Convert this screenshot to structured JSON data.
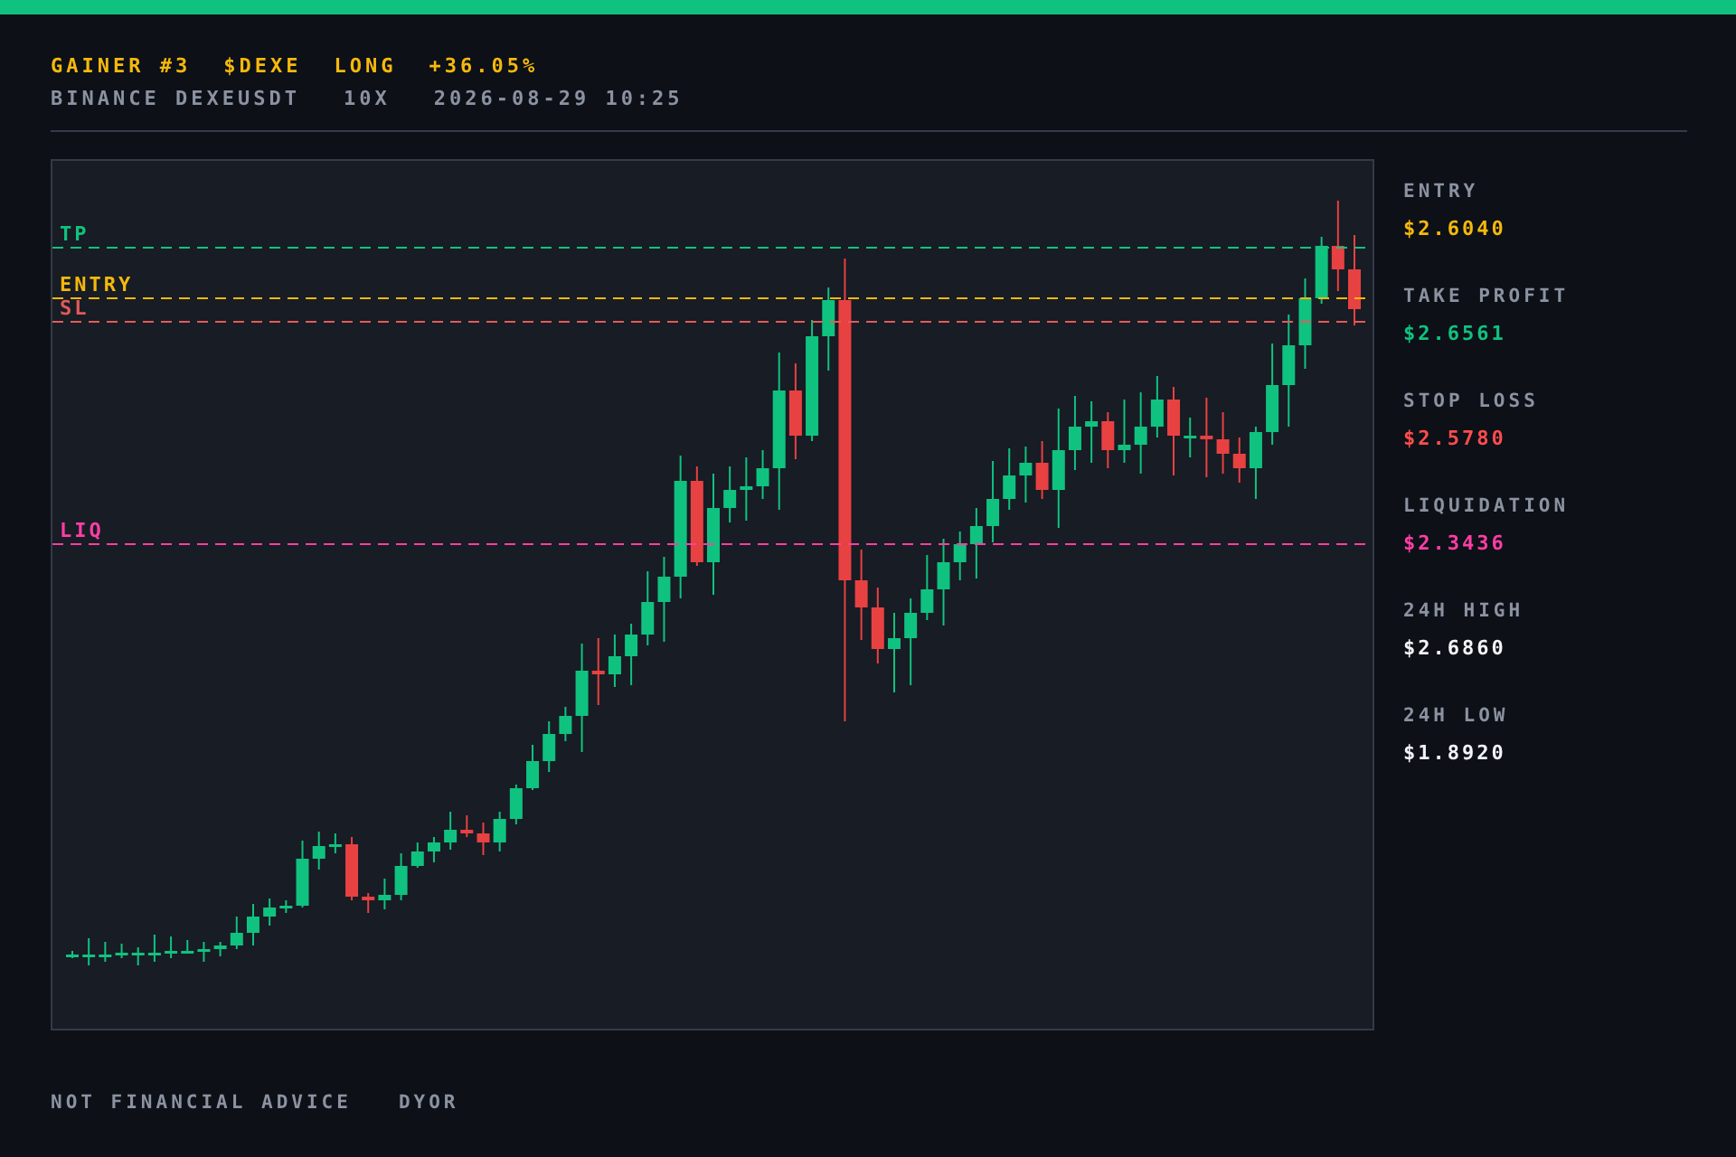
{
  "header": {
    "title_parts": [
      "GAINER #3",
      "$DEXE",
      "LONG",
      "+36.05%"
    ],
    "subtitle_parts": [
      "BINANCE DEXEUSDT",
      "10X",
      "2026-08-29 10:25"
    ]
  },
  "chart": {
    "levels": [
      {
        "label": "TP",
        "color": "#10c27f"
      },
      {
        "label": "ENTRY",
        "color": "#f5b90c"
      },
      {
        "label": "SL",
        "color": "#e35a5a"
      },
      {
        "label": "LIQ",
        "color": "#ff3ea5"
      }
    ]
  },
  "stats": [
    {
      "label": "ENTRY",
      "value": "$2.6040",
      "color": "#f5b90c"
    },
    {
      "label": "TAKE PROFIT",
      "value": "$2.6561",
      "color": "#10c27f"
    },
    {
      "label": "STOP LOSS",
      "value": "$2.5780",
      "color": "#ff4d4d"
    },
    {
      "label": "LIQUIDATION",
      "value": "$2.3436",
      "color": "#ff3ea5"
    },
    {
      "label": "24H HIGH",
      "value": "$2.6860",
      "color": "#f2f4f8"
    },
    {
      "label": "24H LOW",
      "value": "$1.8920",
      "color": "#f2f4f8"
    }
  ],
  "footer": [
    "NOT FINANCIAL ADVICE",
    "DYOR"
  ]
}
